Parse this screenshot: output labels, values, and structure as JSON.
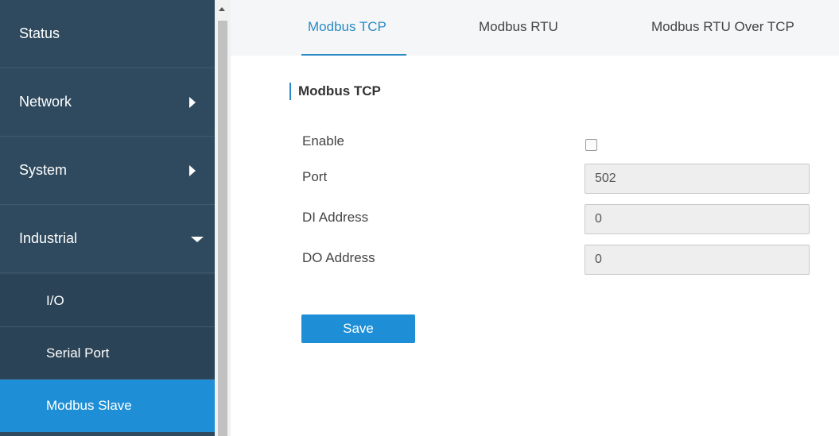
{
  "sidebar": {
    "items": [
      {
        "label": "Status"
      },
      {
        "label": "Network"
      },
      {
        "label": "System"
      },
      {
        "label": "Industrial"
      }
    ],
    "subitems": [
      {
        "label": "I/O"
      },
      {
        "label": "Serial Port"
      },
      {
        "label": "Modbus Slave"
      }
    ]
  },
  "tabs": [
    {
      "label": "Modbus TCP"
    },
    {
      "label": "Modbus RTU"
    },
    {
      "label": "Modbus RTU Over TCP"
    }
  ],
  "form": {
    "section_title": "Modbus TCP",
    "enable_label": "Enable",
    "port_label": "Port",
    "port_value": "502",
    "di_label": "DI Address",
    "di_value": "0",
    "do_label": "DO Address",
    "do_value": "0",
    "save_label": "Save"
  },
  "colors": {
    "sidebar_bg": "#2f4a5e",
    "accent": "#1e8fd6",
    "tab_active": "#2a8bc6"
  }
}
